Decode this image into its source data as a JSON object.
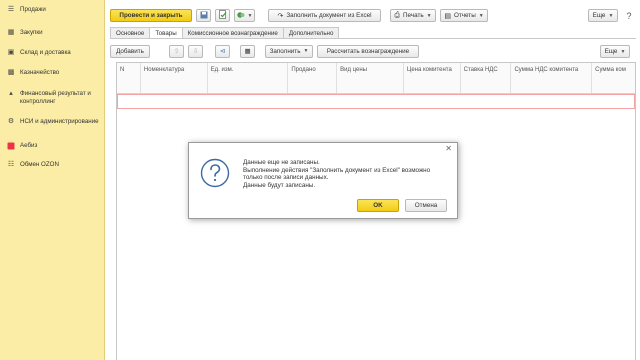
{
  "sidebar": {
    "items": [
      {
        "icon": "list-icon",
        "label": "Продажи"
      },
      {
        "icon": "cart-icon",
        "label": "Закупки"
      },
      {
        "icon": "warehouse-icon",
        "label": "Склад и доставка"
      },
      {
        "icon": "wallet-icon",
        "label": "Казначейство"
      },
      {
        "icon": "chart-icon",
        "label": "Финансовый результат и контроллинг"
      },
      {
        "icon": "gear-icon",
        "label": "НСИ и администрирование"
      },
      {
        "icon": "app-icon",
        "label": "Аебиз"
      },
      {
        "icon": "exchange-icon",
        "label": "Обмен OZON"
      }
    ]
  },
  "toolbar": {
    "post_close": "Провести и закрыть",
    "fill_excel": "Заполнить документ из Excel",
    "print": "Печать",
    "reports": "Отчеты",
    "more": "Еще"
  },
  "tabs": [
    "Основное",
    "Товары",
    "Комиссионное вознаграждение",
    "Дополнительно"
  ],
  "active_tab": "Товары",
  "subbar": {
    "add": "Добавить",
    "fill": "Заполнить",
    "calc": "Рассчитать вознаграждение",
    "more": "Еще"
  },
  "table": {
    "columns": [
      "N",
      "Номенклатура",
      "Ед. изм.",
      "Продано",
      "Вид цены",
      "Цена комитента",
      "Ставка НДС",
      "Сумма НДС комитента",
      "Сумма ком"
    ]
  },
  "dialog": {
    "lines": [
      "Данные еще не записаны.",
      "Выполнение действия \"Заполнить документ из Excel\" возможно",
      "только после записи данных.",
      "Данные будут записаны."
    ],
    "ok": "OK",
    "cancel": "Отмена"
  },
  "colors": {
    "sidebar_bg": "#fbeda5",
    "primary_button": "#f2cc12",
    "row_highlight": "#f3a3a3"
  }
}
